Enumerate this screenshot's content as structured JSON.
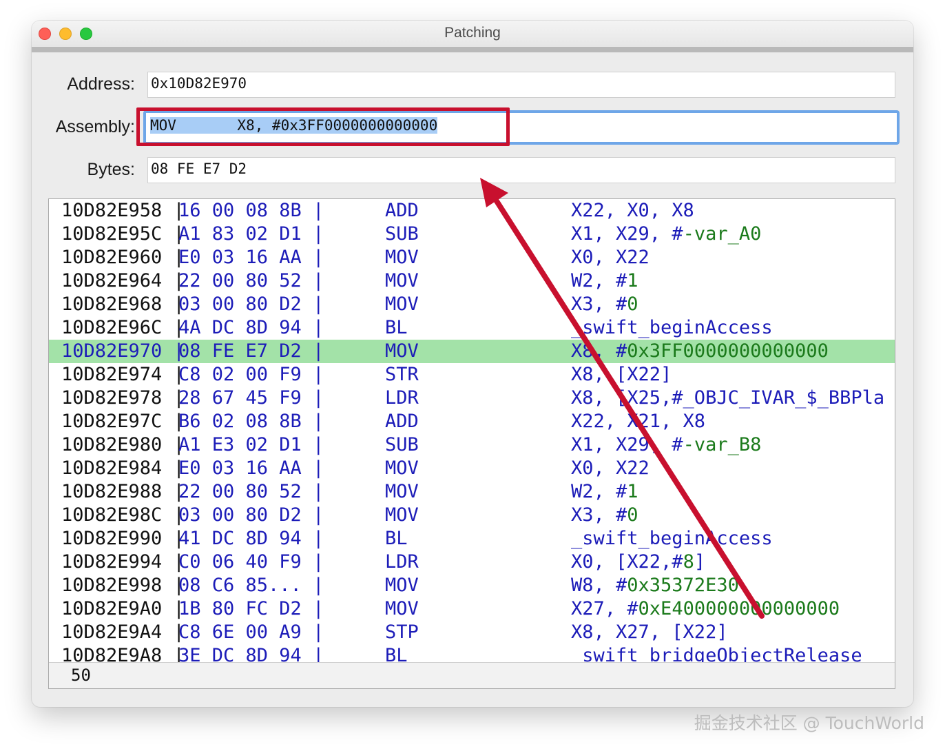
{
  "window": {
    "title": "Patching"
  },
  "fields": {
    "address": {
      "label": "Address:",
      "value": "0x10D82E970"
    },
    "assembly": {
      "label": "Assembly:",
      "value": "MOV       X8, #0x3FF0000000000000"
    },
    "bytes": {
      "label": "Bytes:",
      "value": "08 FE E7 D2"
    }
  },
  "disasm_rows": [
    {
      "addr": "10D82E958",
      "bytes": "16 00 08 8B",
      "mnemonic": "ADD",
      "operands": "X22, X0, X8",
      "highlighted": false
    },
    {
      "addr": "10D82E95C",
      "bytes": "A1 83 02 D1",
      "mnemonic": "SUB",
      "operands": "X1, X29, #-var_A0",
      "highlighted": false
    },
    {
      "addr": "10D82E960",
      "bytes": "E0 03 16 AA",
      "mnemonic": "MOV",
      "operands": "X0, X22",
      "highlighted": false
    },
    {
      "addr": "10D82E964",
      "bytes": "22 00 80 52",
      "mnemonic": "MOV",
      "operands": "W2, #1",
      "highlighted": false
    },
    {
      "addr": "10D82E968",
      "bytes": "03 00 80 D2",
      "mnemonic": "MOV",
      "operands": "X3, #0",
      "highlighted": false
    },
    {
      "addr": "10D82E96C",
      "bytes": "4A DC 8D 94",
      "mnemonic": "BL",
      "operands": "_swift_beginAccess",
      "highlighted": false
    },
    {
      "addr": "10D82E970",
      "bytes": "08 FE E7 D2",
      "mnemonic": "MOV",
      "operands": "X8, #0x3FF0000000000000",
      "highlighted": true
    },
    {
      "addr": "10D82E974",
      "bytes": "C8 02 00 F9",
      "mnemonic": "STR",
      "operands": "X8, [X22]",
      "highlighted": false
    },
    {
      "addr": "10D82E978",
      "bytes": "28 67 45 F9",
      "mnemonic": "LDR",
      "operands": "X8, [X25,#_OBJC_IVAR_$_BBPla",
      "highlighted": false
    },
    {
      "addr": "10D82E97C",
      "bytes": "B6 02 08 8B",
      "mnemonic": "ADD",
      "operands": "X22, X21, X8",
      "highlighted": false
    },
    {
      "addr": "10D82E980",
      "bytes": "A1 E3 02 D1",
      "mnemonic": "SUB",
      "operands": "X1, X29, #-var_B8",
      "highlighted": false
    },
    {
      "addr": "10D82E984",
      "bytes": "E0 03 16 AA",
      "mnemonic": "MOV",
      "operands": "X0, X22",
      "highlighted": false
    },
    {
      "addr": "10D82E988",
      "bytes": "22 00 80 52",
      "mnemonic": "MOV",
      "operands": "W2, #1",
      "highlighted": false
    },
    {
      "addr": "10D82E98C",
      "bytes": "03 00 80 D2",
      "mnemonic": "MOV",
      "operands": "X3, #0",
      "highlighted": false
    },
    {
      "addr": "10D82E990",
      "bytes": "41 DC 8D 94",
      "mnemonic": "BL",
      "operands": "_swift_beginAccess",
      "highlighted": false
    },
    {
      "addr": "10D82E994",
      "bytes": "C0 06 40 F9",
      "mnemonic": "LDR",
      "operands": "X0, [X22,#8]",
      "highlighted": false
    },
    {
      "addr": "10D82E998",
      "bytes": "08 C6 85...",
      "mnemonic": "MOV",
      "operands": "W8, #0x35372E30",
      "highlighted": false
    },
    {
      "addr": "10D82E9A0",
      "bytes": "1B 80 FC D2",
      "mnemonic": "MOV",
      "operands": "X27, #0xE400000000000000",
      "highlighted": false
    },
    {
      "addr": "10D82E9A4",
      "bytes": "C8 6E 00 A9",
      "mnemonic": "STP",
      "operands": "X8, X27, [X22]",
      "highlighted": false
    },
    {
      "addr": "10D82E9A8",
      "bytes": "3E DC 8D 94",
      "mnemonic": "BL",
      "operands": "_swift_bridgeObjectRelease",
      "highlighted": false
    }
  ],
  "status": {
    "value": "50"
  },
  "watermark": "掘金技术社区 @ TouchWorld",
  "colors": {
    "highlight_row": "#a3e2a8",
    "annotation_red": "#c8102e",
    "focus_ring": "#6ea6e8"
  }
}
